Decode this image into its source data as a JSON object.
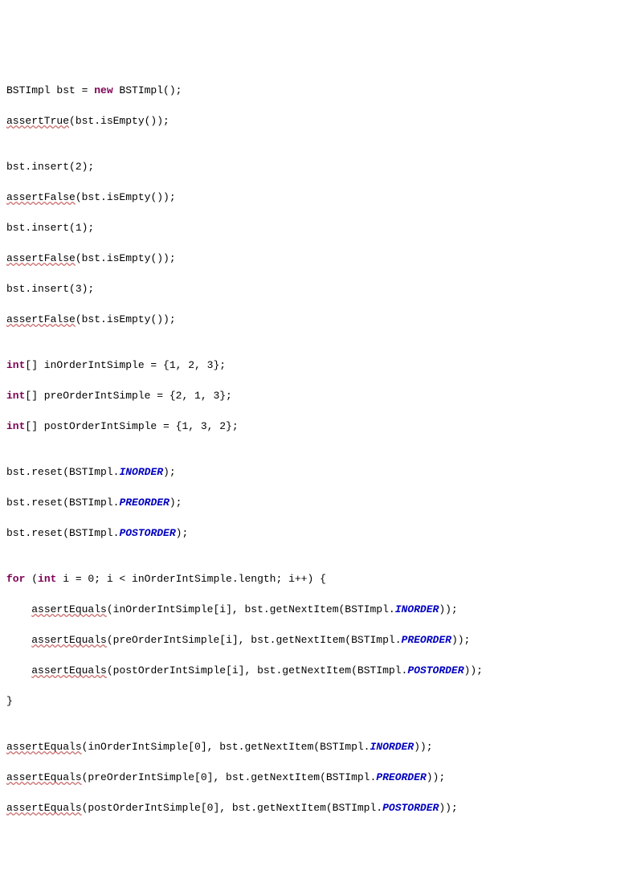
{
  "code": {
    "l1": {
      "t1": "BSTImpl bst = ",
      "kw": "new",
      "t2": " BSTImpl();"
    },
    "l2": {
      "fn": "assertTrue",
      "t": "(bst.isEmpty());"
    },
    "l3": "",
    "l4": {
      "t": "bst.insert(2);"
    },
    "l5": {
      "fn": "assertFalse",
      "t": "(bst.isEmpty());"
    },
    "l6": {
      "t": "bst.insert(1);"
    },
    "l7": {
      "fn": "assertFalse",
      "t": "(bst.isEmpty());"
    },
    "l8": {
      "t": "bst.insert(3);"
    },
    "l9": {
      "fn": "assertFalse",
      "t": "(bst.isEmpty());"
    },
    "l10": "",
    "l11": {
      "kw": "int",
      "t1": "[] inOrderIntSimple = {1, 2, 3};"
    },
    "l12": {
      "kw": "int",
      "t1": "[] preOrderIntSimple = {2, 1, 3};"
    },
    "l13": {
      "kw": "int",
      "t1": "[] postOrderIntSimple = {1, 3, 2};"
    },
    "l14": "",
    "l15": {
      "t1": "bst.reset(BSTImpl.",
      "c": "INORDER",
      "t2": ");"
    },
    "l16": {
      "t1": "bst.reset(BSTImpl.",
      "c": "PREORDER",
      "t2": ");"
    },
    "l17": {
      "t1": "bst.reset(BSTImpl.",
      "c": "POSTORDER",
      "t2": ");"
    },
    "l18": "",
    "l19": {
      "kw1": "for",
      "t1": " (",
      "kw2": "int",
      "t2": " i = 0; i < inOrderIntSimple.length; i++) {"
    },
    "l20": {
      "ind": "    ",
      "fn": "assertEquals",
      "t1": "(inOrderIntSimple[i], bst.getNextItem(BSTImpl.",
      "c": "INORDER",
      "t2": "));"
    },
    "l21": {
      "ind": "    ",
      "fn": "assertEquals",
      "t1": "(preOrderIntSimple[i], bst.getNextItem(BSTImpl.",
      "c": "PREORDER",
      "t2": "));"
    },
    "l22": {
      "ind": "    ",
      "fn": "assertEquals",
      "t1": "(postOrderIntSimple[i], bst.getNextItem(BSTImpl.",
      "c": "POSTORDER",
      "t2": "));"
    },
    "l23": {
      "t": "}"
    },
    "l24": "",
    "l25": {
      "fn": "assertEquals",
      "t1": "(inOrderIntSimple[0], bst.getNextItem(BSTImpl.",
      "c": "INORDER",
      "t2": "));"
    },
    "l26": {
      "fn": "assertEquals",
      "t1": "(preOrderIntSimple[0], bst.getNextItem(BSTImpl.",
      "c": "PREORDER",
      "t2": "));"
    },
    "l27": {
      "fn": "assertEquals",
      "t1": "(postOrderIntSimple[0], bst.getNextItem(BSTImpl.",
      "c": "POSTORDER",
      "t2": "));"
    }
  }
}
